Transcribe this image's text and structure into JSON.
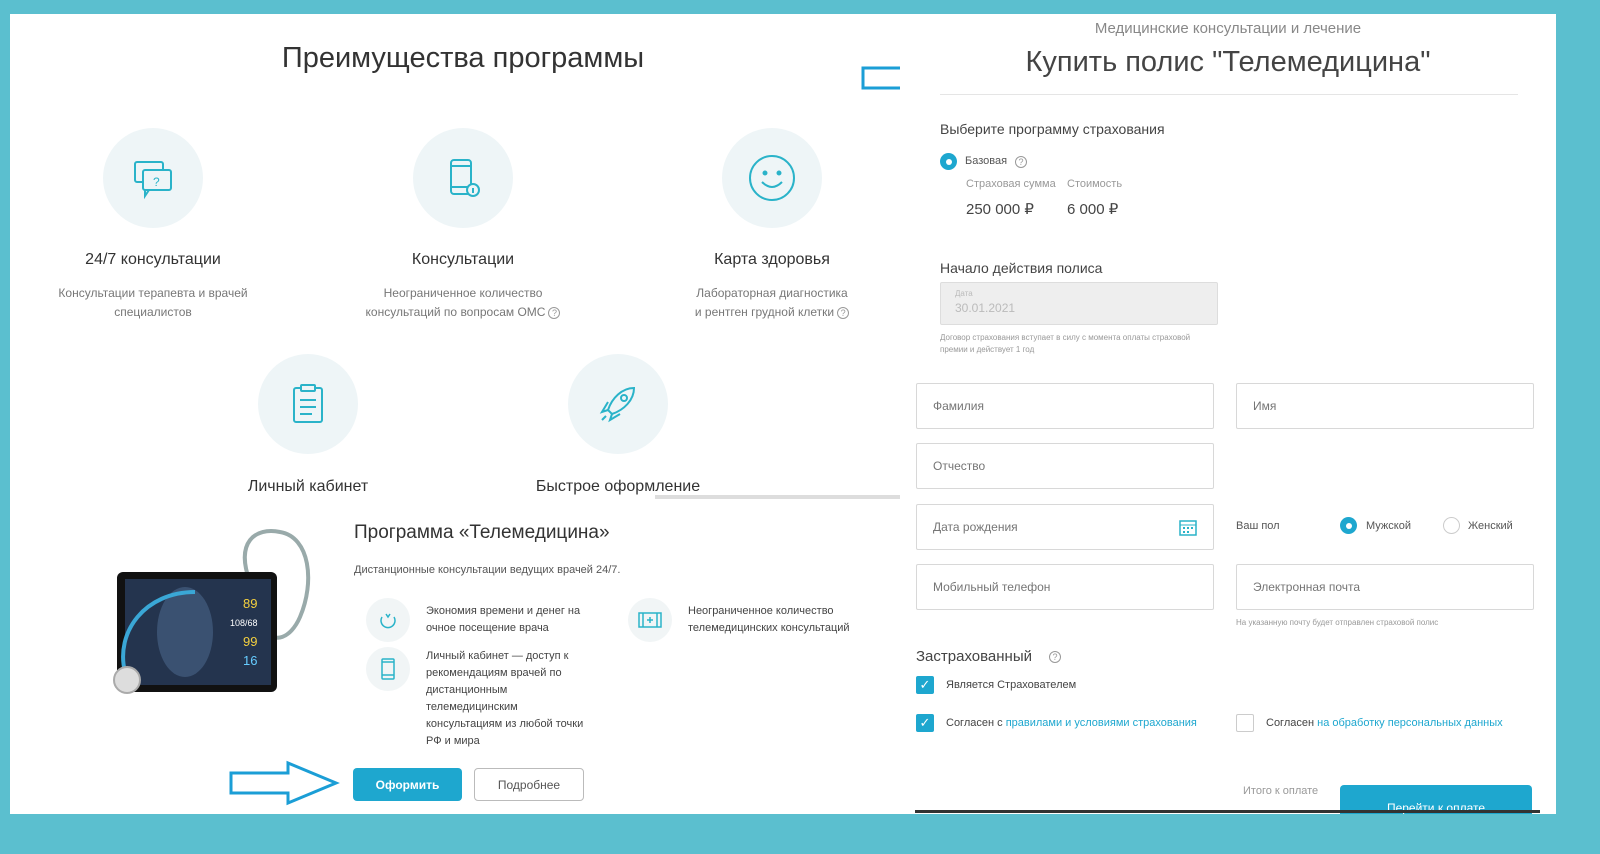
{
  "left": {
    "title": "Преимущества программы",
    "features": [
      {
        "icon": "chat-question-icon",
        "label": "24/7 консультации",
        "desc": [
          "Консультации терапевта и врачей",
          "специалистов"
        ]
      },
      {
        "icon": "phone-info-icon",
        "label": "Консультации",
        "desc": [
          "Неограниченное количество",
          "консультаций по вопросам ОМС"
        ]
      },
      {
        "icon": "smile-icon",
        "label": "Карта здоровья",
        "desc": [
          "Лабораторная диагностика",
          "и рентген грудной клетки"
        ]
      },
      {
        "icon": "clipboard-icon",
        "label": "Личный кабинет"
      },
      {
        "icon": "rocket-icon",
        "label": "Быстрое оформление"
      }
    ],
    "program": {
      "title": "Программа «Телемедицина»",
      "subtitle": "Дистанционные консультации ведущих врачей 24/7.",
      "benefits": [
        {
          "icon": "apple-icon",
          "lines": [
            "Экономия времени и денег на",
            "очное посещение врача"
          ]
        },
        {
          "icon": "screen-plus-icon",
          "lines": [
            "Неограниченное количество",
            "телемедицинских консультаций"
          ]
        },
        {
          "icon": "smartphone-icon",
          "lines": [
            "Личный кабинет — доступ к",
            "рекомендациям врачей по",
            "дистанционным",
            "телемедицинским",
            "консультациям из любой точки",
            "РФ и мира"
          ]
        }
      ],
      "tablet_readings": [
        "89",
        "108/68",
        "99",
        "16"
      ],
      "apply_button": "Оформить",
      "more_button": "Подробнее"
    }
  },
  "right": {
    "category": "Медицинские консультации и лечение",
    "title": "Купить полис \"Телемедицина\"",
    "choose_program": "Выберите программу страхования",
    "program_option": "Базовая",
    "sum_label": "Страховая сумма",
    "cost_label": "Стоимость",
    "sum_value": "250 000 ₽",
    "cost_value": "6 000 ₽",
    "start_label": "Начало действия полиса",
    "date_label": "Дата",
    "date_value": "30.01.2021",
    "date_note": [
      "Договор страхования вступает в силу с момента оплаты страховой",
      "премии и действует 1 год"
    ],
    "fields": {
      "last_name": "Фамилия",
      "first_name": "Имя",
      "middle_name": "Отчество",
      "birth_date": "Дата рождения",
      "phone": "Мобильный телефон",
      "email": "Электронная почта"
    },
    "gender_label": "Ваш пол",
    "gender_male": "Мужской",
    "gender_female": "Женский",
    "email_note": "На указанную почту будет отправлен страховой полис",
    "insured_title": "Застрахованный",
    "is_policyholder": "Является Страхователем",
    "agree_prefix": "Согласен с ",
    "agree_rules_link": "правилами и условиями страхования",
    "agree_pd_prefix": "Согласен ",
    "agree_pd_link": "на обработку персональных данных",
    "total_label": "Итого к оплате",
    "pay_button": "Перейти к оплате"
  },
  "colors": {
    "accent": "#1ea7cf",
    "frame": "#5bbfcf",
    "arrow": "#1b9ed6"
  }
}
